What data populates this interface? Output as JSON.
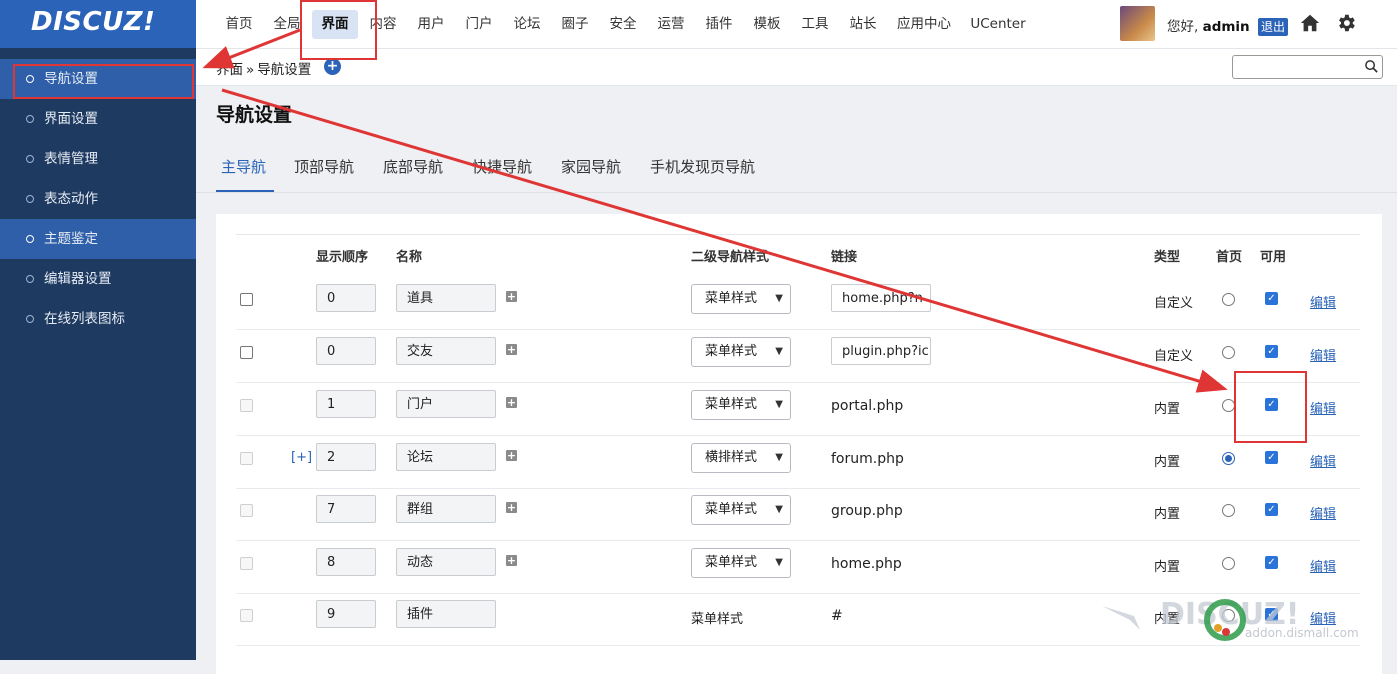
{
  "app": {
    "logo_text": "DISCUZ!"
  },
  "top_nav": {
    "items": [
      {
        "label": "首页",
        "active": false
      },
      {
        "label": "全局",
        "active": false
      },
      {
        "label": "界面",
        "active": true
      },
      {
        "label": "内容",
        "active": false
      },
      {
        "label": "用户",
        "active": false
      },
      {
        "label": "门户",
        "active": false
      },
      {
        "label": "论坛",
        "active": false
      },
      {
        "label": "圈子",
        "active": false
      },
      {
        "label": "安全",
        "active": false
      },
      {
        "label": "运营",
        "active": false
      },
      {
        "label": "插件",
        "active": false
      },
      {
        "label": "模板",
        "active": false
      },
      {
        "label": "工具",
        "active": false
      },
      {
        "label": "站长",
        "active": false
      },
      {
        "label": "应用中心",
        "active": false
      },
      {
        "label": "UCenter",
        "active": false
      }
    ],
    "greeting": "您好,",
    "username": "admin",
    "logout_label": "退出",
    "icons": [
      "avatar",
      "home-icon",
      "gear-icon"
    ]
  },
  "sidebar": {
    "items": [
      {
        "label": "导航设置",
        "active": true
      },
      {
        "label": "界面设置",
        "active": false
      },
      {
        "label": "表情管理",
        "active": false
      },
      {
        "label": "表态动作",
        "active": false
      },
      {
        "label": "主题鉴定",
        "active": true
      },
      {
        "label": "编辑器设置",
        "active": false
      },
      {
        "label": "在线列表图标",
        "active": false
      }
    ]
  },
  "breadcrumb": {
    "root": "界面",
    "separator": "»",
    "current": "导航设置"
  },
  "search": {
    "value": "",
    "placeholder": ""
  },
  "page": {
    "title": "导航设置",
    "tabs": [
      {
        "label": "主导航",
        "active": true
      },
      {
        "label": "顶部导航",
        "active": false
      },
      {
        "label": "底部导航",
        "active": false
      },
      {
        "label": "快捷导航",
        "active": false
      },
      {
        "label": "家园导航",
        "active": false
      },
      {
        "label": "手机发现页导航",
        "active": false
      }
    ]
  },
  "table": {
    "headers": {
      "order": "显示顺序",
      "name": "名称",
      "sub_style": "二级导航样式",
      "link": "链接",
      "type": "类型",
      "home": "首页",
      "enabled": "可用"
    },
    "rows": [
      {
        "checkbox_enabled": true,
        "expand": "",
        "order": "0",
        "name": "道具",
        "style": "菜单样式",
        "style_editable": true,
        "link": "home.php?n",
        "link_editable": true,
        "type": "自定义",
        "home": false,
        "enabled": true,
        "edit": "编辑",
        "has_add": true
      },
      {
        "checkbox_enabled": true,
        "expand": "",
        "order": "0",
        "name": "交友",
        "style": "菜单样式",
        "style_editable": true,
        "link": "plugin.php?ic",
        "link_editable": true,
        "type": "自定义",
        "home": false,
        "enabled": true,
        "edit": "编辑",
        "has_add": true
      },
      {
        "checkbox_enabled": false,
        "expand": "",
        "order": "1",
        "name": "门户",
        "style": "菜单样式",
        "style_editable": true,
        "link": "portal.php",
        "link_editable": false,
        "type": "内置",
        "home": false,
        "enabled": true,
        "edit": "编辑",
        "has_add": true
      },
      {
        "checkbox_enabled": false,
        "expand": "[+]",
        "order": "2",
        "name": "论坛",
        "style": "横排样式",
        "style_editable": true,
        "link": "forum.php",
        "link_editable": false,
        "type": "内置",
        "home": true,
        "enabled": true,
        "edit": "编辑",
        "has_add": true
      },
      {
        "checkbox_enabled": false,
        "expand": "",
        "order": "7",
        "name": "群组",
        "style": "菜单样式",
        "style_editable": true,
        "link": "group.php",
        "link_editable": false,
        "type": "内置",
        "home": false,
        "enabled": true,
        "edit": "编辑",
        "has_add": true
      },
      {
        "checkbox_enabled": false,
        "expand": "",
        "order": "8",
        "name": "动态",
        "style": "菜单样式",
        "style_editable": true,
        "link": "home.php",
        "link_editable": false,
        "type": "内置",
        "home": false,
        "enabled": true,
        "edit": "编辑",
        "has_add": true
      },
      {
        "checkbox_enabled": false,
        "expand": "",
        "order": "9",
        "name": "插件",
        "style": "菜单样式",
        "style_editable": false,
        "link": "#",
        "link_editable": false,
        "type": "内置",
        "home": false,
        "enabled": true,
        "edit": "编辑",
        "has_add": false
      }
    ]
  },
  "watermark": {
    "text": "addon.dismall.com"
  },
  "colors": {
    "accent": "#2a63b8",
    "sidebar_bg": "#1f3a60",
    "annotation": "#e03535"
  }
}
